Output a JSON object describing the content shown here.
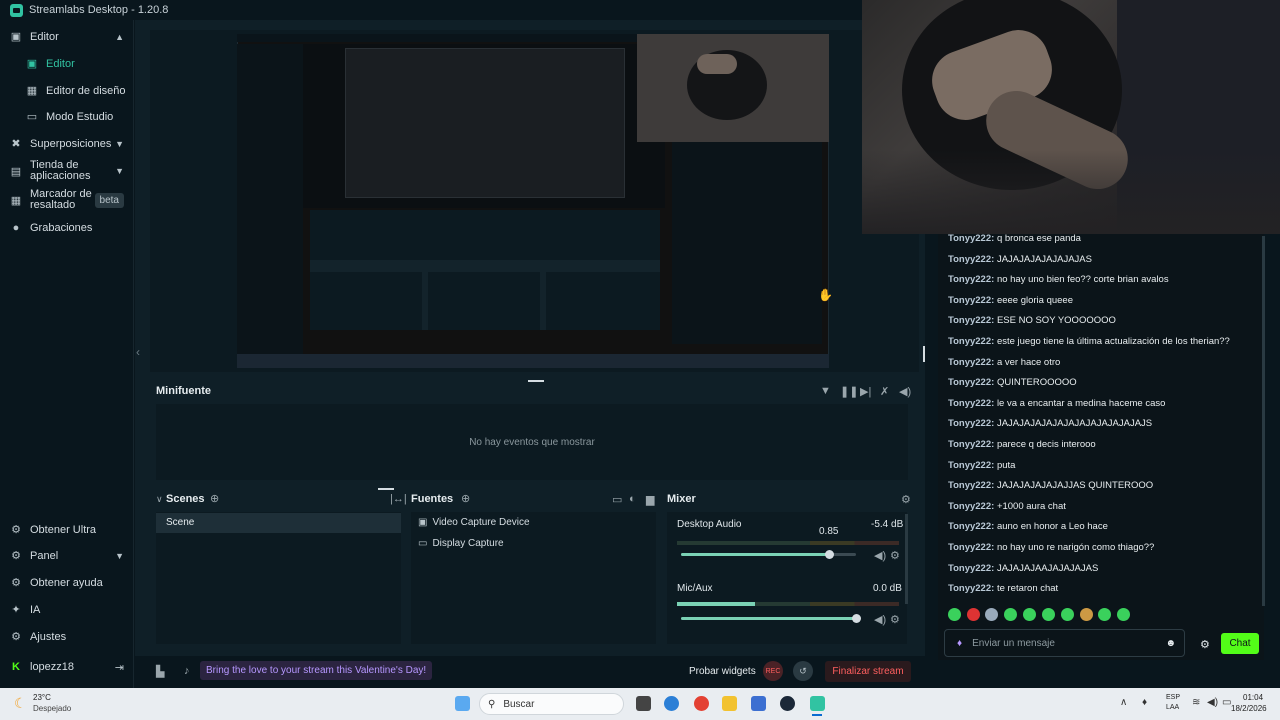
{
  "window": {
    "title": "Streamlabs Desktop - 1.20.8"
  },
  "sidebar": {
    "items": [
      {
        "label": "Editor",
        "icon": "editor-icon"
      },
      {
        "label": "Editor",
        "icon": "editor-icon"
      },
      {
        "label": "Editor de diseño",
        "icon": "layout-icon"
      },
      {
        "label": "Modo Estudio",
        "icon": "studio-icon"
      },
      {
        "label": "Superposiciones",
        "icon": "overlay-icon"
      },
      {
        "label": "Tienda de aplicaciones",
        "icon": "store-icon"
      },
      {
        "label": "Marcador de resaltado",
        "icon": "highlight-icon",
        "badge": "beta"
      },
      {
        "label": "Grabaciones",
        "icon": "recordings-icon"
      }
    ],
    "bottom": [
      {
        "label": "Obtener Ultra",
        "icon": "ultra-icon"
      },
      {
        "label": "Panel",
        "icon": "panel-icon"
      },
      {
        "label": "Obtener ayuda",
        "icon": "help-icon"
      },
      {
        "label": "IA",
        "icon": "ai-icon"
      },
      {
        "label": "Ajustes",
        "icon": "settings-icon"
      },
      {
        "label": "lopezz18",
        "icon": "kick-icon"
      }
    ]
  },
  "minifuente": {
    "title": "Minifuente",
    "empty_text": "No hay eventos que mostrar"
  },
  "scenes": {
    "title": "Scenes",
    "items": [
      "Scene"
    ]
  },
  "sources": {
    "title": "Fuentes",
    "items": [
      "Video Capture Device",
      "Display Capture"
    ]
  },
  "mixer": {
    "title": "Mixer",
    "channels": [
      {
        "name": "Desktop Audio",
        "db": "-5.4 dB",
        "volume_label": "0.85",
        "volume": 0.85,
        "level": 0.0
      },
      {
        "name": "Mic/Aux",
        "db": "0.0 dB",
        "volume_label": "",
        "volume": 1.0,
        "level": 0.35
      }
    ]
  },
  "footer": {
    "promo": "Bring the love to your stream this Valentine's Day!",
    "test_widgets": "Probar widgets",
    "rec": "REC",
    "end_stream": "Finalizar stream"
  },
  "chat": {
    "messages": [
      {
        "user": "Tonyy222:",
        "text": "q bronca ese panda"
      },
      {
        "user": "Tonyy222:",
        "text": "JAJAJAJAJAJAJAJAS"
      },
      {
        "user": "Tonyy222:",
        "text": "no hay uno bien feo?? corte brian avalos"
      },
      {
        "user": "Tonyy222:",
        "text": "eeee gloria queee"
      },
      {
        "user": "Tonyy222:",
        "text": "ESE NO SOY YOOOOOOO"
      },
      {
        "user": "Tonyy222:",
        "text": "este juego tiene la última actualización de los therian??"
      },
      {
        "user": "Tonyy222:",
        "text": "a ver hace otro"
      },
      {
        "user": "Tonyy222:",
        "text": "QUINTEROOOOO"
      },
      {
        "user": "Tonyy222:",
        "text": "le va a encantar a medina haceme caso"
      },
      {
        "user": "Tonyy222:",
        "text": "JAJAJAJAJAJAJAJAJAJAJAJAJAJS"
      },
      {
        "user": "Tonyy222:",
        "text": "parece q decis interooo"
      },
      {
        "user": "Tonyy222:",
        "text": "puta"
      },
      {
        "user": "Tonyy222:",
        "text": "JAJAJAJAJAJAJJAS QUINTEROOO"
      },
      {
        "user": "Tonyy222:",
        "text": "+1000 aura chat"
      },
      {
        "user": "Tonyy222:",
        "text": "auno en honor a Leo hace"
      },
      {
        "user": "Tonyy222:",
        "text": "no hay uno re narigón como thiago??"
      },
      {
        "user": "Tonyy222:",
        "text": "JAJAJAJAAJAJAJAJAS"
      },
      {
        "user": "Tonyy222:",
        "text": "te retaron chat"
      }
    ],
    "input_placeholder": "Enviar un mensaje",
    "send_label": "Chat"
  },
  "taskbar": {
    "weather_temp": "23°C",
    "weather_desc": "Despejado",
    "search": "Buscar",
    "lang1": "ESP",
    "lang2": "LAA",
    "time": "01:04",
    "date": "18/2/2026"
  },
  "colors": {
    "accent": "#31c3a2",
    "kick_green": "#53fc18",
    "danger": "#ff5f5f",
    "promo": "#b697ff"
  }
}
